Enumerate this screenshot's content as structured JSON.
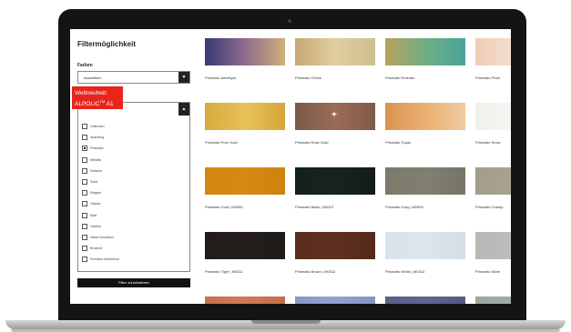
{
  "sidebar": {
    "title": "Filtermöglichkeit",
    "color_label": "Farben",
    "select_value": "Auswählen",
    "badge_line1": "Weltneuheit:",
    "badge_line2": "ALPOLIC",
    "badge_sup": "TM",
    "badge_suffix": " A1",
    "options": [
      {
        "label": "Uniforben",
        "checked": false
      },
      {
        "label": "Sparkling",
        "checked": false
      },
      {
        "label": "Prismatic",
        "checked": true
      },
      {
        "label": "Metallic",
        "checked": false
      },
      {
        "label": "Dessine",
        "checked": false
      },
      {
        "label": "Solid",
        "checked": false
      },
      {
        "label": "Elegant",
        "checked": false
      },
      {
        "label": "Classic",
        "checked": false
      },
      {
        "label": "Matt",
        "checked": false
      },
      {
        "label": "Hairline",
        "checked": false
      },
      {
        "label": "Nickel Anodized",
        "checked": false
      },
      {
        "label": "Brushed",
        "checked": false
      },
      {
        "label": "Premium Aluminium",
        "checked": false
      }
    ],
    "apply_label": "Filter zurücksetzen"
  },
  "icons": {
    "select_arrow": "▼",
    "collapse_arrow": "▲",
    "plus": "+"
  },
  "grid": {
    "rows": [
      [
        {
          "label": "Prismatic Amethyst",
          "colors": [
            "#3a3a73",
            "#8e6b8d",
            "#d2b07a"
          ]
        },
        {
          "label": "Prismatic Citrine",
          "colors": [
            "#c9a774",
            "#e0cfa0",
            "#cdbf8f"
          ]
        },
        {
          "label": "Prismatic Emerald",
          "colors": [
            "#b9a15c",
            "#6fae85",
            "#4aa49a"
          ]
        },
        {
          "label": "Prismatic Pearl",
          "colors": [
            "#f0cdb6",
            "#f3dfcf",
            "#f6e8de"
          ]
        }
      ],
      [
        {
          "label": "Prismatic Pure Gold",
          "colors": [
            "#d6a93c",
            "#e8c25a",
            "#d7a53a"
          ]
        },
        {
          "label": "Prismatic Rose Gold",
          "colors": [
            "#7b5a49",
            "#9b6b56",
            "#7e5b48"
          ],
          "plus": true
        },
        {
          "label": "Prismatic Topaz",
          "colors": [
            "#d8944f",
            "#eab172",
            "#f1caa0"
          ]
        },
        {
          "label": "Prismatic Snow",
          "colors": [
            "#f1f1ec",
            "#f6f6f2",
            "#eeeeea"
          ]
        }
      ],
      [
        {
          "label": "Prismatic Gold | M0306",
          "colors": [
            "#d48711",
            "#d58a14",
            "#cf830f"
          ]
        },
        {
          "label": "Prismatic Black | M0307",
          "colors": [
            "#14201c",
            "#16231f",
            "#121c19"
          ]
        },
        {
          "label": "Prismatic Gray | M0309",
          "colors": [
            "#7c7a6c",
            "#817f70",
            "#777568"
          ]
        },
        {
          "label": "Prismatic Champ",
          "colors": [
            "#a39d8c",
            "#a8a290",
            "#9e9886"
          ]
        }
      ],
      [
        {
          "label": "Prismatic Tiger | M0311",
          "colors": [
            "#211c19",
            "#241f1c",
            "#1e1a17"
          ]
        },
        {
          "label": "Prismatic Brown | M0312",
          "colors": [
            "#5a2d1f",
            "#5e3020",
            "#552a1c"
          ]
        },
        {
          "label": "Prismatic White | M0313",
          "colors": [
            "#d9e1ea",
            "#dde5ee",
            "#d4dde6"
          ]
        },
        {
          "label": "Prismatic Silver",
          "colors": [
            "#b7b9b7",
            "#bcbebc",
            "#b2b4b2"
          ]
        }
      ],
      [
        {
          "label": "",
          "colors": [
            "#c9704c",
            "#cf7a57",
            "#c66c48"
          ]
        },
        {
          "label": "",
          "colors": [
            "#8a97c9",
            "#94a0cf",
            "#8692c4"
          ]
        },
        {
          "label": "",
          "colors": [
            "#5b5e88",
            "#62658e",
            "#565983"
          ]
        },
        {
          "label": "",
          "colors": [
            "#9aa7a0",
            "#a0ada6",
            "#95a29b"
          ]
        }
      ]
    ]
  }
}
